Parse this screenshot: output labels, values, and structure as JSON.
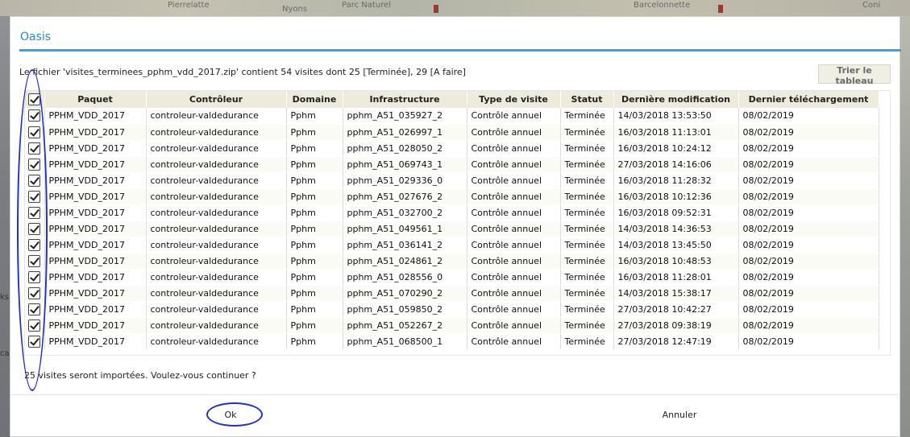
{
  "background_map": {
    "labels": [
      "Pierrelatte",
      "Nyons",
      "Parc Naturel",
      "Barcelonnette",
      "Coni"
    ],
    "side_labels": [
      "ks",
      "ca"
    ]
  },
  "dialog": {
    "title": "Oasis",
    "info": "Le fichier 'visites_terminees_pphm_vdd_2017.zip' contient 54 visites dont 25 [Terminée], 29 [A faire]",
    "sort_button": "Trier le tableau",
    "table": {
      "columns": [
        "Paquet",
        "Contrôleur",
        "Domaine",
        "Infrastructure",
        "Type de visite",
        "Statut",
        "Dernière modification",
        "Dernier téléchargement"
      ],
      "rows": [
        [
          "PPHM_VDD_2017",
          "controleur-valdedurance",
          "Pphm",
          "pphm_A51_035927_2",
          "Contrôle annuel",
          "Terminée",
          "14/03/2018 13:53:50",
          "08/02/2019"
        ],
        [
          "PPHM_VDD_2017",
          "controleur-valdedurance",
          "Pphm",
          "pphm_A51_026997_1",
          "Contrôle annuel",
          "Terminée",
          "16/03/2018 11:13:01",
          "08/02/2019"
        ],
        [
          "PPHM_VDD_2017",
          "controleur-valdedurance",
          "Pphm",
          "pphm_A51_028050_2",
          "Contrôle annuel",
          "Terminée",
          "16/03/2018 10:24:12",
          "08/02/2019"
        ],
        [
          "PPHM_VDD_2017",
          "controleur-valdedurance",
          "Pphm",
          "pphm_A51_069743_1",
          "Contrôle annuel",
          "Terminée",
          "27/03/2018 14:16:06",
          "08/02/2019"
        ],
        [
          "PPHM_VDD_2017",
          "controleur-valdedurance",
          "Pphm",
          "pphm_A51_029336_0",
          "Contrôle annuel",
          "Terminée",
          "16/03/2018 11:28:32",
          "08/02/2019"
        ],
        [
          "PPHM_VDD_2017",
          "controleur-valdedurance",
          "Pphm",
          "pphm_A51_027676_2",
          "Contrôle annuel",
          "Terminée",
          "16/03/2018 10:12:36",
          "08/02/2019"
        ],
        [
          "PPHM_VDD_2017",
          "controleur-valdedurance",
          "Pphm",
          "pphm_A51_032700_2",
          "Contrôle annuel",
          "Terminée",
          "16/03/2018 09:52:31",
          "08/02/2019"
        ],
        [
          "PPHM_VDD_2017",
          "controleur-valdedurance",
          "Pphm",
          "pphm_A51_049561_1",
          "Contrôle annuel",
          "Terminée",
          "14/03/2018 14:36:53",
          "08/02/2019"
        ],
        [
          "PPHM_VDD_2017",
          "controleur-valdedurance",
          "Pphm",
          "pphm_A51_036141_2",
          "Contrôle annuel",
          "Terminée",
          "14/03/2018 13:45:50",
          "08/02/2019"
        ],
        [
          "PPHM_VDD_2017",
          "controleur-valdedurance",
          "Pphm",
          "pphm_A51_024861_2",
          "Contrôle annuel",
          "Terminée",
          "16/03/2018 10:48:53",
          "08/02/2019"
        ],
        [
          "PPHM_VDD_2017",
          "controleur-valdedurance",
          "Pphm",
          "pphm_A51_028556_0",
          "Contrôle annuel",
          "Terminée",
          "16/03/2018 11:28:01",
          "08/02/2019"
        ],
        [
          "PPHM_VDD_2017",
          "controleur-valdedurance",
          "Pphm",
          "pphm_A51_070290_2",
          "Contrôle annuel",
          "Terminée",
          "14/03/2018 15:38:17",
          "08/02/2019"
        ],
        [
          "PPHM_VDD_2017",
          "controleur-valdedurance",
          "Pphm",
          "pphm_A51_059850_2",
          "Contrôle annuel",
          "Terminée",
          "27/03/2018 10:42:27",
          "08/02/2019"
        ],
        [
          "PPHM_VDD_2017",
          "controleur-valdedurance",
          "Pphm",
          "pphm_A51_052267_2",
          "Contrôle annuel",
          "Terminée",
          "27/03/2018 09:38:19",
          "08/02/2019"
        ],
        [
          "PPHM_VDD_2017",
          "controleur-valdedurance",
          "Pphm",
          "pphm_A51_068500_1",
          "Contrôle annuel",
          "Terminée",
          "27/03/2018 12:47:19",
          "08/02/2019"
        ]
      ]
    },
    "summary": "25 visites seront importées. Voulez-vous continuer ?",
    "ok_button": "Ok",
    "cancel_button": "Annuler"
  },
  "colors": {
    "accent": "#2fa4e7",
    "title": "#2a8ad0",
    "header_bg": "#ecebdc",
    "annotation": "#1f2fd0"
  },
  "icons": [
    "checkbox-checked-icon",
    "scroll-up-icon",
    "scroll-down-icon"
  ]
}
